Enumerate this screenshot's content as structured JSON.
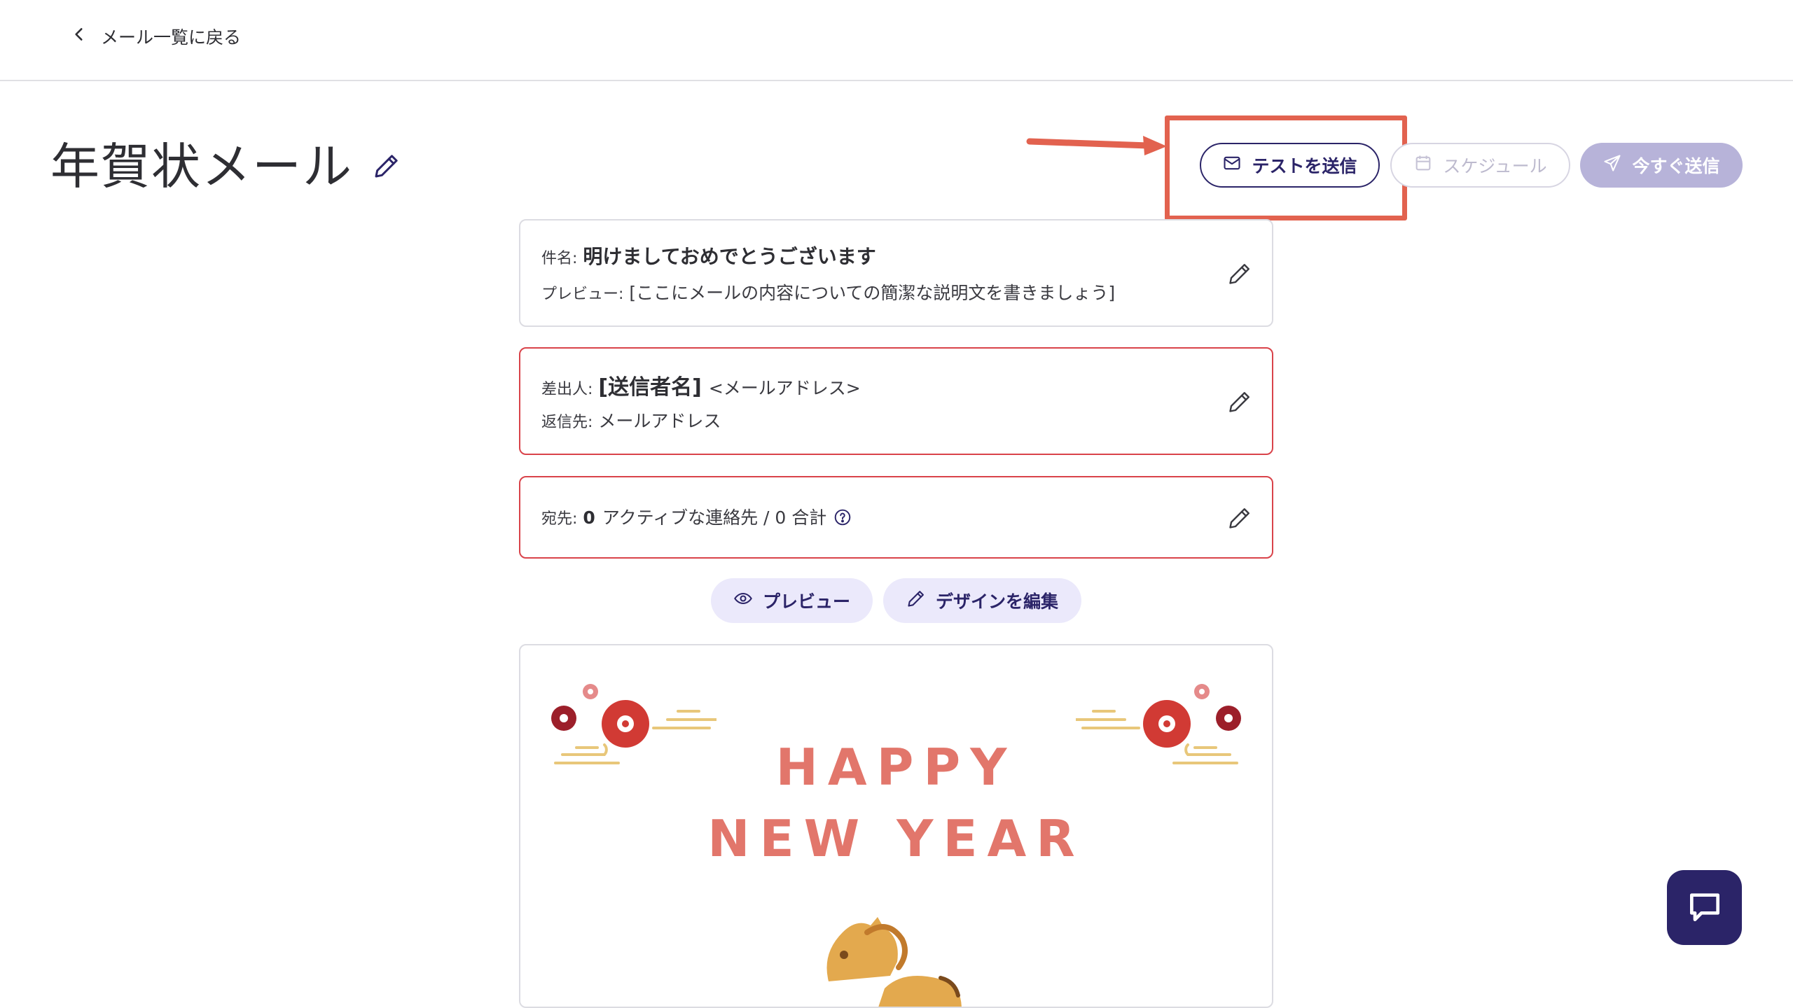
{
  "nav": {
    "back_label": "メール一覧に戻る"
  },
  "page": {
    "title": "年賀状メール"
  },
  "toolbar": {
    "test_send_label": "テストを送信",
    "schedule_label": "スケジュール",
    "send_now_label": "今すぐ送信"
  },
  "subject_card": {
    "subject_label": "件名:",
    "subject_value": "明けましておめでとうございます",
    "preview_label": "プレビュー:",
    "preview_value": "[ここにメールの内容についての簡潔な説明文を書きましょう]"
  },
  "sender_card": {
    "from_label": "差出人:",
    "from_name": "[送信者名]",
    "from_address": "<メールアドレス>",
    "reply_label": "返信先:",
    "reply_value": "メールアドレス"
  },
  "recipient_card": {
    "to_label": "宛先:",
    "active_count": "0",
    "summary": "アクティブな連絡先 / 0 合計"
  },
  "actions": {
    "preview_label": "プレビュー",
    "edit_design_label": "デザインを編集"
  },
  "email_content": {
    "line1": "HAPPY",
    "line2": "NEW YEAR"
  },
  "colors": {
    "primary": "#2b2468",
    "error_border": "#d9434a",
    "highlight": "#e2624f",
    "pill_bg": "#ebe9fb",
    "greeting_text": "#e2766b"
  },
  "icons": {
    "back": "chevron-left-icon",
    "edit": "pencil-icon",
    "test": "envelope-icon",
    "schedule": "calendar-icon",
    "send": "paper-plane-icon",
    "help": "question-circle-icon",
    "preview": "eye-icon",
    "chat": "chat-bubble-icon"
  }
}
